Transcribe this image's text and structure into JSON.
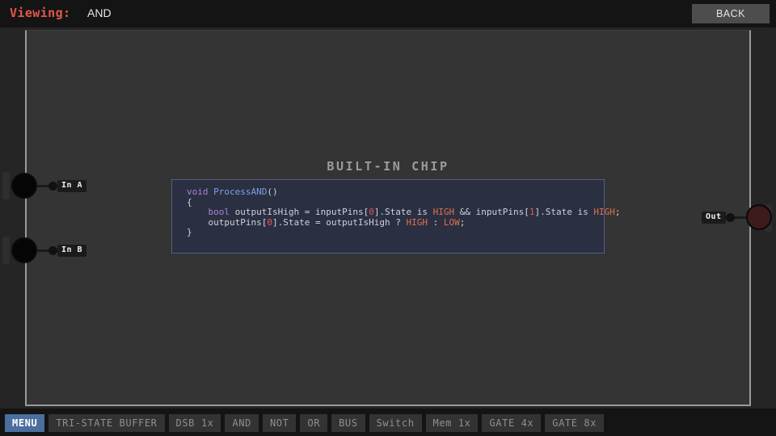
{
  "header": {
    "viewing_label": "Viewing:",
    "viewing_value": "AND",
    "back_label": "BACK",
    "accent_color": "#e2574c"
  },
  "workspace": {
    "builtin_title": "BUILT-IN CHIP",
    "input_pins": [
      {
        "label": "In A",
        "state": "LOW"
      },
      {
        "label": "In B",
        "state": "LOW"
      }
    ],
    "output_pins": [
      {
        "label": "Out",
        "state": "LOW"
      }
    ],
    "code": {
      "lines": [
        [
          {
            "t": "void ",
            "c": "kw"
          },
          {
            "t": "ProcessAND",
            "c": "fn"
          },
          {
            "t": "()",
            "c": "plain"
          }
        ],
        [
          {
            "t": "{",
            "c": "plain"
          }
        ],
        [
          {
            "t": "    ",
            "c": "plain"
          },
          {
            "t": "bool",
            "c": "kw"
          },
          {
            "t": " outputIsHigh = inputPins[",
            "c": "plain"
          },
          {
            "t": "0",
            "c": "num"
          },
          {
            "t": "].State is ",
            "c": "plain"
          },
          {
            "t": "HIGH",
            "c": "const"
          },
          {
            "t": " && inputPins[",
            "c": "plain"
          },
          {
            "t": "1",
            "c": "num"
          },
          {
            "t": "].State is ",
            "c": "plain"
          },
          {
            "t": "HIGH",
            "c": "const"
          },
          {
            "t": ";",
            "c": "plain"
          }
        ],
        [
          {
            "t": "    outputPins[",
            "c": "plain"
          },
          {
            "t": "0",
            "c": "num"
          },
          {
            "t": "].State = outputIsHigh ? ",
            "c": "plain"
          },
          {
            "t": "HIGH",
            "c": "const"
          },
          {
            "t": " : ",
            "c": "plain"
          },
          {
            "t": "LOW",
            "c": "const"
          },
          {
            "t": ";",
            "c": "plain"
          }
        ],
        [
          {
            "t": "}",
            "c": "plain"
          }
        ]
      ]
    }
  },
  "bottombar": {
    "items": [
      {
        "label": "MENU",
        "active": true
      },
      {
        "label": "TRI-STATE BUFFER",
        "active": false
      },
      {
        "label": "DSB 1x",
        "active": false
      },
      {
        "label": "AND",
        "active": false
      },
      {
        "label": "NOT",
        "active": false
      },
      {
        "label": "OR",
        "active": false
      },
      {
        "label": "BUS",
        "active": false
      },
      {
        "label": "Switch",
        "active": false
      },
      {
        "label": "Mem 1x",
        "active": false
      },
      {
        "label": "GATE 4x",
        "active": false
      },
      {
        "label": "GATE 8x",
        "active": false
      }
    ]
  }
}
